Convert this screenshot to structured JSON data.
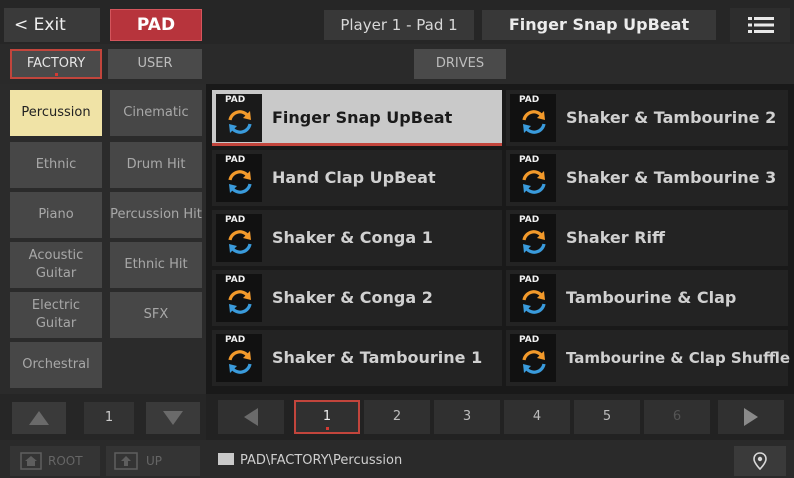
{
  "header": {
    "exit_label": "< Exit",
    "mode_label": "PAD",
    "player_label": "Player 1 - Pad 1",
    "selected_pad": "Finger Snap UpBeat",
    "menu_icon": "menu-icon"
  },
  "tabs": {
    "factory": "FACTORY",
    "user": "USER",
    "drives": "DRIVES"
  },
  "categories": [
    {
      "label": "Percussion"
    },
    {
      "label": "Cinematic"
    },
    {
      "label": "Ethnic"
    },
    {
      "label": "Drum Hit"
    },
    {
      "label": "Piano"
    },
    {
      "label": "Percussion Hit"
    },
    {
      "label": "Acoustic Guitar"
    },
    {
      "label": "Ethnic Hit"
    },
    {
      "label": "Electric Guitar"
    },
    {
      "label": "SFX"
    },
    {
      "label": "Orchestral"
    }
  ],
  "category_page": "1",
  "pads": [
    {
      "tag": "PAD",
      "name": "Finger Snap UpBeat"
    },
    {
      "tag": "PAD",
      "name": "Shaker & Tambourine 2"
    },
    {
      "tag": "PAD",
      "name": "Hand Clap UpBeat"
    },
    {
      "tag": "PAD",
      "name": "Shaker & Tambourine 3"
    },
    {
      "tag": "PAD",
      "name": "Shaker & Conga 1"
    },
    {
      "tag": "PAD",
      "name": "Shaker Riff"
    },
    {
      "tag": "PAD",
      "name": "Shaker & Conga 2"
    },
    {
      "tag": "PAD",
      "name": "Tambourine & Clap"
    },
    {
      "tag": "PAD",
      "name": "Shaker & Tambourine 1"
    },
    {
      "tag": "PAD",
      "name": "Tambourine & Clap Shuffle"
    }
  ],
  "pages": [
    "1",
    "2",
    "3",
    "4",
    "5",
    "6"
  ],
  "status": {
    "root_label": "ROOT",
    "up_label": "UP",
    "path": "PAD\\FACTORY\\Percussion"
  },
  "colors": {
    "accent_red": "#b7343c",
    "selected_category": "#f0e3a6",
    "pad_icon_orange": "#f39a2b",
    "pad_icon_blue": "#3a9bdc"
  }
}
